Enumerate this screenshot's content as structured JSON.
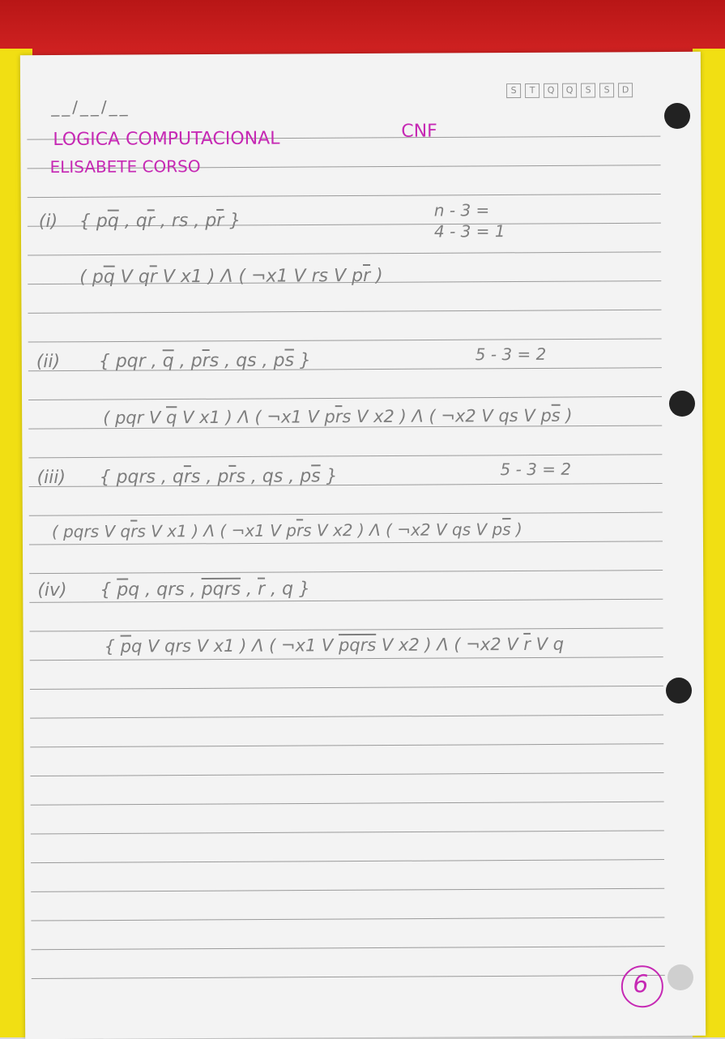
{
  "checkboxes": [
    "S",
    "T",
    "Q",
    "Q",
    "S",
    "S",
    "D"
  ],
  "date_template": "__/__/__",
  "header": {
    "title": "LOGICA COMPUTACIONAL",
    "subject": "CNF",
    "author": "ELISABETE CORSO"
  },
  "exercises": [
    {
      "label": "(i)",
      "set": [
        "{ p",
        "q",
        " , q",
        "r",
        " , rs , p",
        "r",
        " }"
      ],
      "count": [
        "n - 3 =",
        "4 - 3 = 1"
      ],
      "cnf": [
        "( p",
        "q",
        " V q",
        "r",
        " V x1 ) Λ ( ¬x1 V rs V p",
        "r",
        " )"
      ]
    },
    {
      "label": "(ii)",
      "set": [
        "{ pqr , ",
        "q",
        " , p",
        "r",
        "s , qs , p",
        "s",
        " }"
      ],
      "count": "5 - 3 = 2",
      "cnf": [
        "( pqr V ",
        "q",
        " V x1 ) Λ ( ¬x1 V p",
        "r",
        "s V x2 ) Λ ( ¬x2 V qs V p",
        "s",
        " )"
      ]
    },
    {
      "label": "(iii)",
      "set": [
        "{ pqrs , q",
        "r",
        "s , p",
        "r",
        "s , qs , p",
        "s",
        " }"
      ],
      "count": "5 - 3 = 2",
      "cnf": [
        "( pqrs V q",
        "r",
        "s V x1 ) Λ ( ¬x1 V p",
        "r",
        "s V x2 ) Λ ( ¬x2 V qs V p",
        "s",
        " )"
      ]
    },
    {
      "label": "(iv)",
      "set": [
        "{ ",
        "p",
        "q , qrs , ",
        "pqrs",
        " , ",
        "r",
        " , q }"
      ],
      "cnf": [
        "{ ",
        "p",
        "q V qrs V x1 ) Λ ( ¬x1 V ",
        "pqrs",
        " V x2 ) Λ ( ¬x2 V ",
        "r",
        " V q"
      ]
    }
  ],
  "page_number": "6"
}
